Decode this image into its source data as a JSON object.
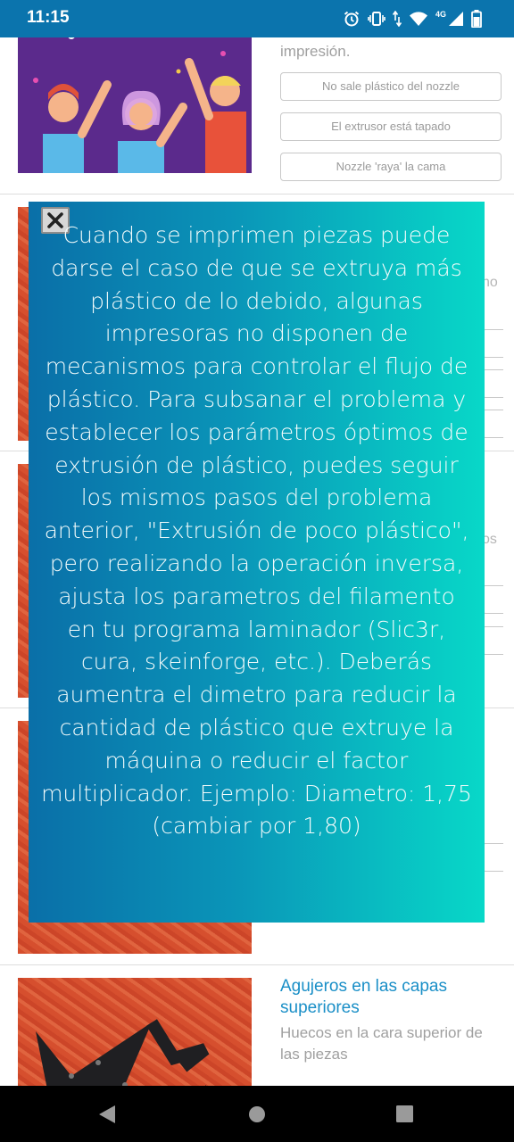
{
  "status_bar": {
    "time": "11:15",
    "network": "4G"
  },
  "cards": [
    {
      "description_tail": "impresión.",
      "options": [
        "No sale plástico del nozzle",
        "El extrusor está tapado",
        "Nozzle 'raya' la cama"
      ]
    },
    {
      "side_text": "no"
    },
    {
      "side_text": "os"
    },
    {},
    {
      "title": "Agujeros en las capas superiores",
      "description": "Huecos en la cara superior de las piezas"
    }
  ],
  "modal": {
    "close_symbol": "×",
    "text": "Cuando se imprimen piezas puede darse el caso de que se extruya más plástico de lo debido, algunas impresoras no disponen de mecanismos para controlar el flujo de plástico. Para subsanar el problema y establecer los parámetros óptimos de extrusión de plástico, puedes seguir los mismos pasos del problema anterior, \"Extrusión de poco plástico\", pero realizando la operación inversa, ajusta los parametros del filamento en tu programa laminador (Slic3r, cura, skeinforge, etc.). Deberás aumentra el dimetro para reducir la cantidad de plástico que extruye la máquina o reducir el factor multiplicador. Ejemplo: Diametro: 1,75 (cambiar por 1,80)"
  },
  "colors": {
    "status_bar": "#0b74ad",
    "link": "#1a8fc7",
    "modal_start": "#0a6fa8",
    "modal_end": "#08d8c8"
  },
  "icons": [
    "alarm-icon",
    "vibrate-icon",
    "data-arrows-icon",
    "wifi-icon",
    "signal-icon",
    "battery-icon",
    "close-icon",
    "back-icon",
    "home-icon",
    "recents-icon"
  ]
}
